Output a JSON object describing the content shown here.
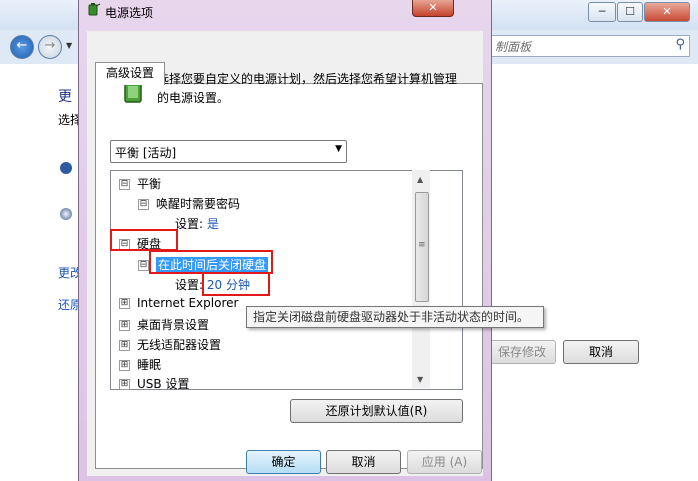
{
  "background": {
    "controls": {
      "min": "─",
      "max": "☐",
      "close": "✕"
    },
    "nav": {
      "back": "←",
      "forward": "→",
      "dropdown": "▼"
    },
    "search_text": "制面板",
    "heading": "更",
    "desc": "选择",
    "link1": "更改",
    "link2": "还原",
    "save_button": "保存修改",
    "cancel_button": "取消"
  },
  "dialog": {
    "title": "电源选项",
    "close_glyph": "✕",
    "tab": "高级设置",
    "intro": "选择您要自定义的电源计划，然后选择您希望计算机管理的电源设置。",
    "plan_select": {
      "value": "平衡 [活动]",
      "arrow": "▼"
    },
    "tree": {
      "expander_open": "⊟",
      "expander_closed": "⊞",
      "balanced": "平衡",
      "wake_password": "唤醒时需要密码",
      "setting_label": "设置:",
      "wake_value": "是",
      "hard_disk": "硬盘",
      "turn_off_disk": "在此时间后关闭硬盘",
      "disk_value": "20 分钟",
      "items": [
        "Internet Explorer",
        "桌面背景设置",
        "无线适配器设置",
        "睡眠",
        "USB 设置"
      ]
    },
    "scroll": {
      "up": "▲",
      "down": "▼",
      "grip": "≡"
    },
    "tooltip": "指定关闭磁盘前硬盘驱动器处于非活动状态的时间。",
    "buttons": {
      "restore": "还原计划默认值(R)",
      "ok": "确定",
      "cancel": "取消",
      "apply": "应用 (A)"
    }
  }
}
